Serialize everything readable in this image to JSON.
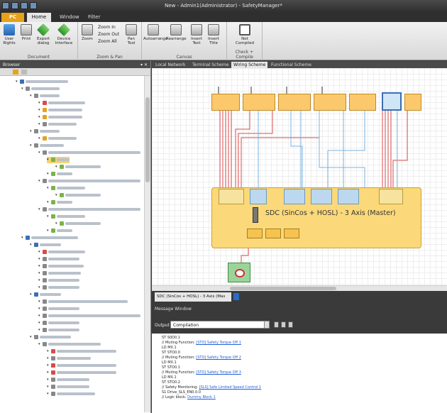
{
  "window": {
    "title": "New - Admin1(Administrator) - SafetyManager*"
  },
  "tabs": {
    "file": "PC",
    "home": "Home",
    "window": "Window",
    "filter": "Filter"
  },
  "ribbon": {
    "document": {
      "label": "Document",
      "user_rights": "User Rights",
      "print": "Print",
      "export_dialog": "Export dialog",
      "device_interface": "Device Interface"
    },
    "zoom_pan": {
      "label": "Zoom & Pan",
      "zoom": "Zoom",
      "zoom_in": "Zoom In",
      "zoom_out": "Zoom Out",
      "zoom_all": "Zoom All",
      "pan_tool": "Pan Tool"
    },
    "canvas": {
      "label": "Canvas",
      "autoarrange": "Autoarrange",
      "rearrange": "Rearrange",
      "insert_text": "Insert Text",
      "insert_title": "Insert Title"
    },
    "check_compile": {
      "label": "Check + Compile",
      "status": "Not Compiled"
    }
  },
  "browser": {
    "title": "Browser"
  },
  "doc_tabs": [
    "Local Network",
    "Terminal Scheme",
    "Wiring Scheme",
    "Functional Scheme"
  ],
  "canvas": {
    "main_block_title": "SDC (SinCos + HOSL) - 3 Axis (Master)"
  },
  "sheet_tab": "SDC (SinCos + HOSL) - 3 Axis (Mas",
  "message_window": {
    "title": "Message Window",
    "output_label": "Output",
    "output_value": "Compilation"
  },
  "log": [
    {
      "text": "ST S0D0.1"
    },
    {
      "text": "// Muting Function: ",
      "link": "[STO] Safety Torque Off 1"
    },
    {
      "text": "LD MX.1"
    },
    {
      "text": "ST STO0.0"
    },
    {
      "text": "// Muting Function: ",
      "link": "[STO] Safety Torque Off 2"
    },
    {
      "text": "LD MX.1"
    },
    {
      "text": "ST STO0.1"
    },
    {
      "text": "// Muting Function: ",
      "link": "[STO] Safety Torque Off 3"
    },
    {
      "text": "LD MX.1"
    },
    {
      "text": "ST STO0.2"
    },
    {
      "text": "// Safety Monitoring: ",
      "link": "[SLS] Safe Limited Speed Control 1"
    },
    {
      "text": "S1 Drive_SLS_EN0.0.0"
    },
    {
      "text": "// Logic block: ",
      "link": "Dummy Block 1"
    }
  ],
  "colors": {
    "accent": "#e7a21a",
    "block": "#fbc96c",
    "block_blue": "#cfe6f7",
    "main_block": "#fbd97a",
    "link": "#1f5fd6",
    "selection": "#f7d36a"
  }
}
